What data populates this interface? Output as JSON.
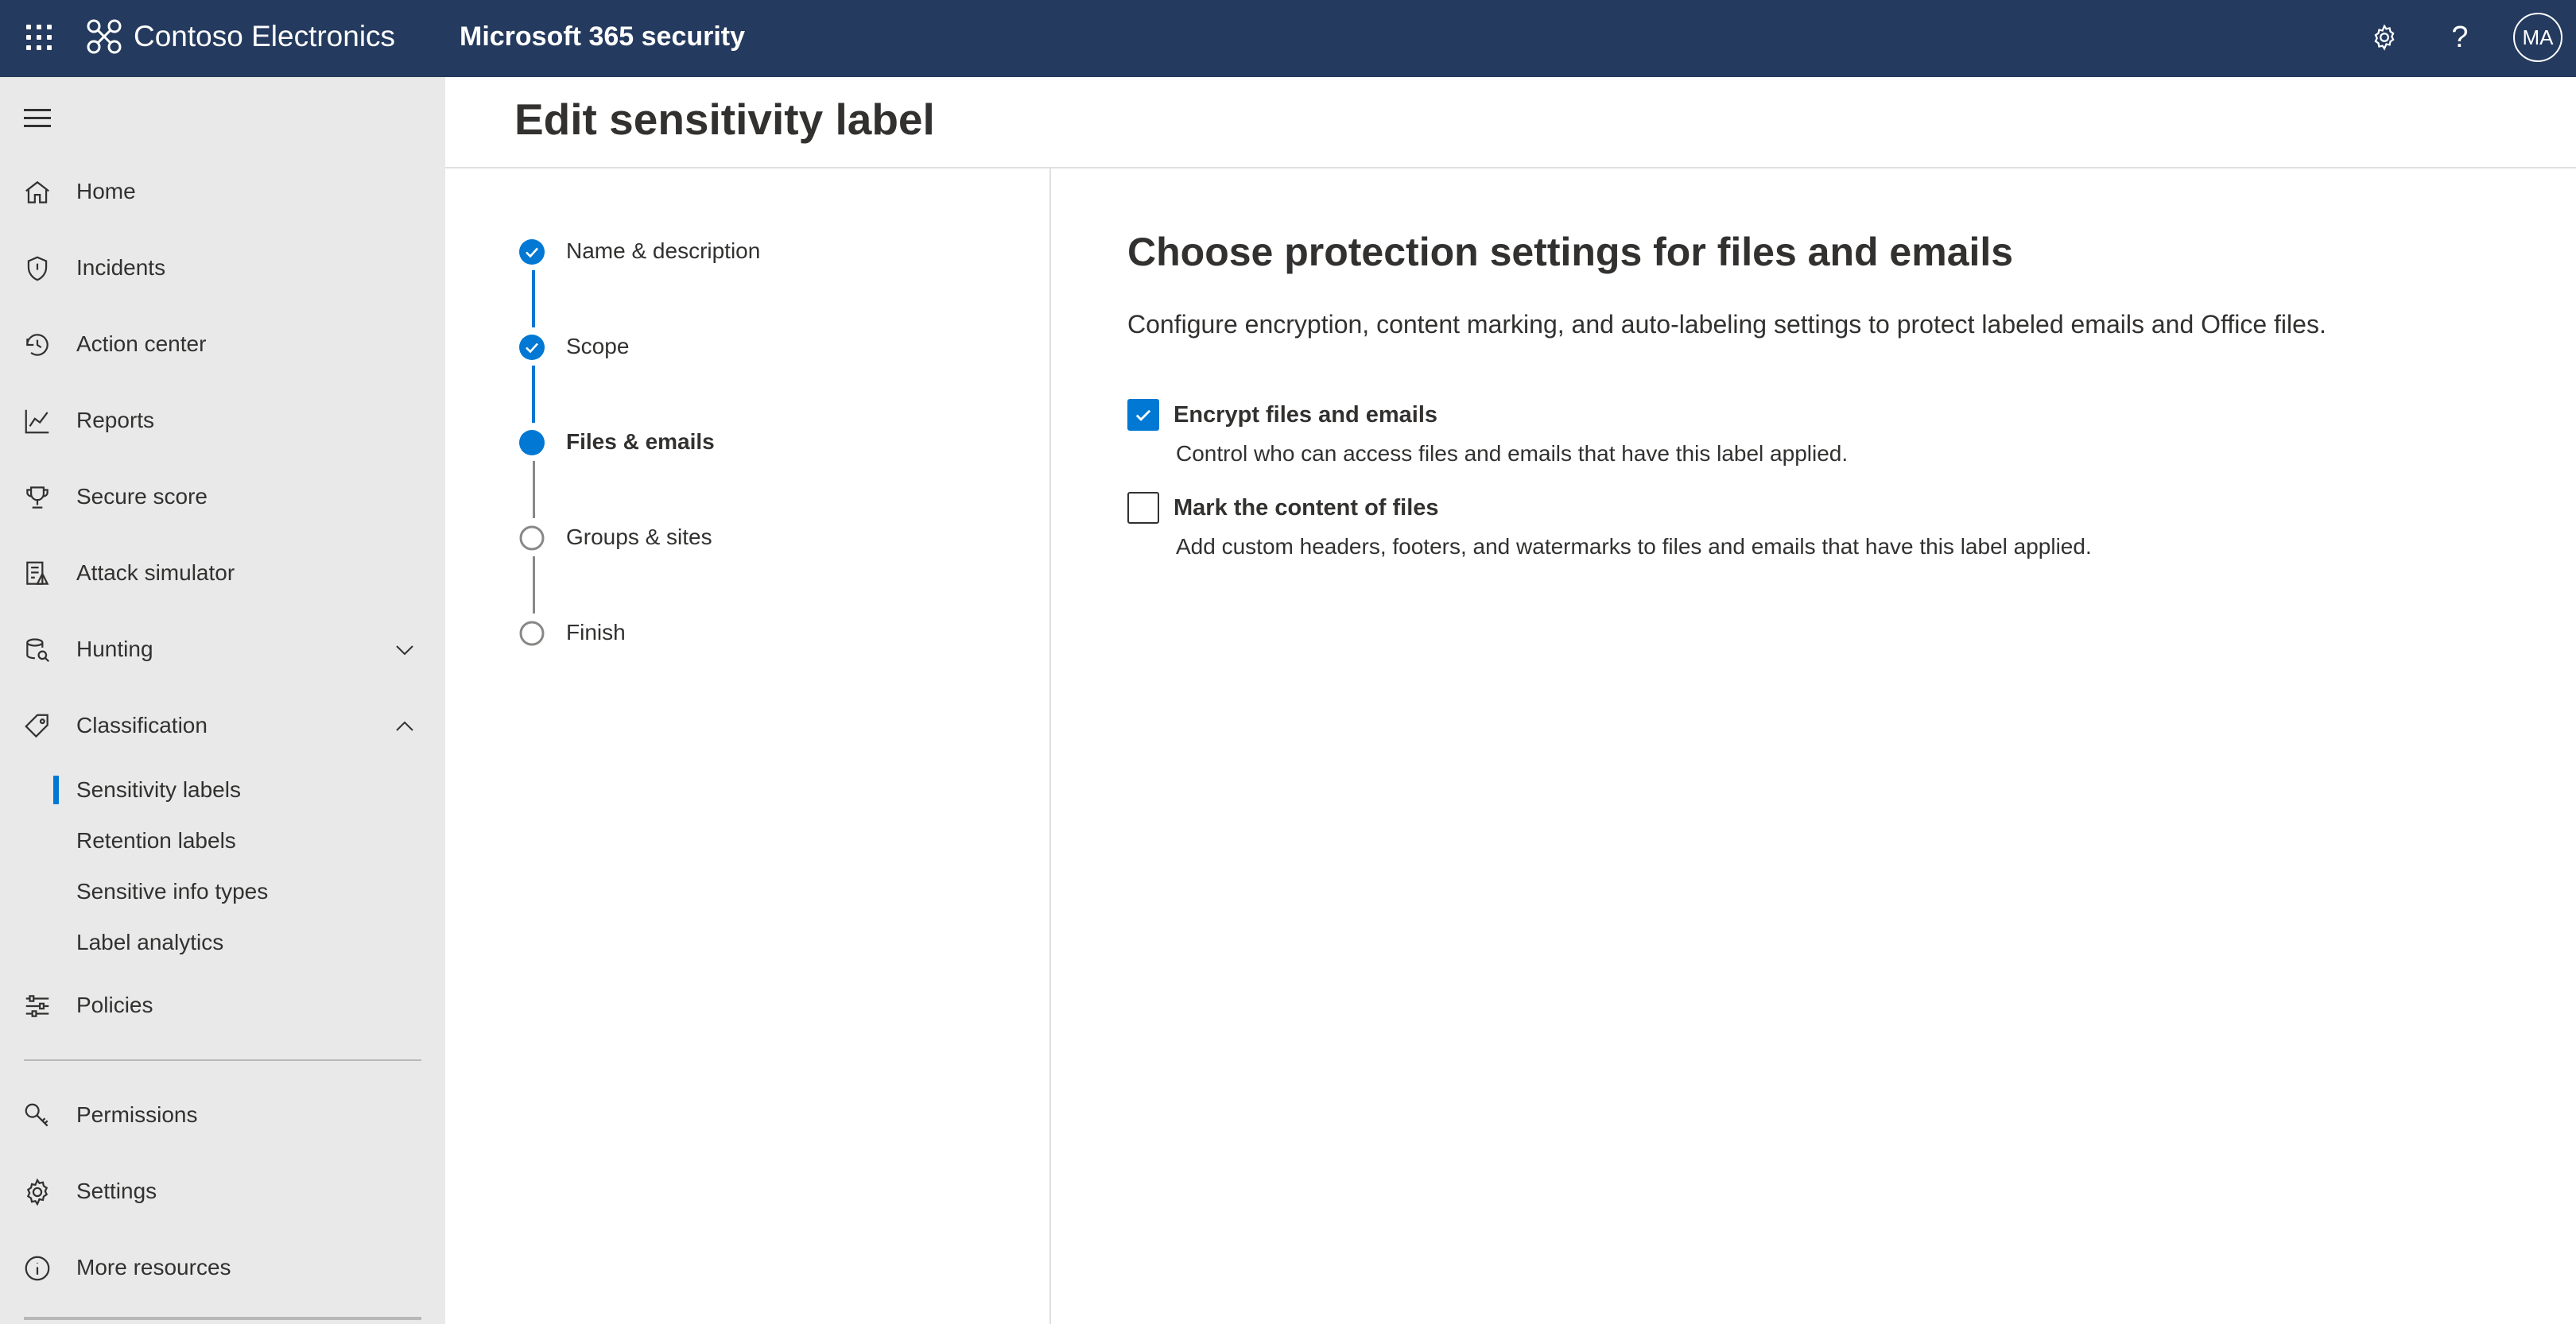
{
  "topbar": {
    "brand_name": "Contoso Electronics",
    "app_title": "Microsoft 365 security",
    "avatar_initials": "MA",
    "background": "#243a5e"
  },
  "sidebar": {
    "items": [
      {
        "label": "Home",
        "icon": "home-icon"
      },
      {
        "label": "Incidents",
        "icon": "shield-icon"
      },
      {
        "label": "Action center",
        "icon": "action-center-icon"
      },
      {
        "label": "Reports",
        "icon": "chart-icon"
      },
      {
        "label": "Secure score",
        "icon": "trophy-icon"
      },
      {
        "label": "Attack simulator",
        "icon": "attack-simulator-icon"
      },
      {
        "label": "Hunting",
        "icon": "hunting-icon",
        "expandable": true,
        "expanded": false
      },
      {
        "label": "Classification",
        "icon": "tag-icon",
        "expandable": true,
        "expanded": true
      }
    ],
    "classification_subitems": [
      {
        "label": "Sensitivity labels",
        "active": true
      },
      {
        "label": "Retention labels",
        "active": false
      },
      {
        "label": "Sensitive info types",
        "active": false
      },
      {
        "label": "Label analytics",
        "active": false
      }
    ],
    "policies_label": "Policies",
    "bottom_items": [
      {
        "label": "Permissions",
        "icon": "key-icon"
      },
      {
        "label": "Settings",
        "icon": "gear-icon"
      },
      {
        "label": "More resources",
        "icon": "info-icon"
      }
    ]
  },
  "page": {
    "title": "Edit sensitivity label"
  },
  "wizard": {
    "steps": [
      {
        "label": "Name & description",
        "status": "complete"
      },
      {
        "label": "Scope",
        "status": "complete"
      },
      {
        "label": "Files & emails",
        "status": "current"
      },
      {
        "label": "Groups & sites",
        "status": "pending"
      },
      {
        "label": "Finish",
        "status": "pending"
      }
    ]
  },
  "content": {
    "title": "Choose protection settings for files and emails",
    "description": "Configure encryption, content marking, and auto-labeling settings to protect labeled emails and Office files.",
    "options": [
      {
        "label": "Encrypt files and emails",
        "description": "Control who can access files and emails that have this label applied.",
        "checked": true
      },
      {
        "label": "Mark the content of files",
        "description": "Add custom headers, footers, and watermarks to files and emails that have this label applied.",
        "checked": false
      }
    ]
  },
  "colors": {
    "accent": "#0078d4",
    "sidebar_bg": "#e9e9e9",
    "text": "#323130"
  }
}
